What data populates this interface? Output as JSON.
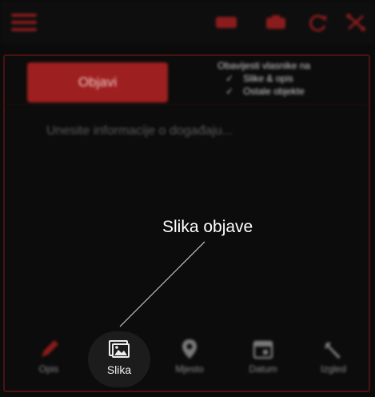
{
  "header": {
    "icons": [
      "menu-icon",
      "ticket-icon",
      "camera-icon",
      "refresh-icon",
      "share-icon"
    ]
  },
  "composer": {
    "publish_label": "Objavi",
    "notify_title": "Obavijesti vlasnike na",
    "notify_options": [
      "Slike & opis",
      "Ostale objekte"
    ],
    "placeholder": "Unesite informacije o događaju..."
  },
  "tabs": [
    {
      "label": "Opis",
      "icon": "pencil-icon"
    },
    {
      "label": "Slika",
      "icon": "image-icon"
    },
    {
      "label": "Mjesto",
      "icon": "location-pin-icon"
    },
    {
      "label": "Datum",
      "icon": "calendar-icon"
    },
    {
      "label": "Izgled",
      "icon": "wrench-icon"
    }
  ],
  "tooltip": {
    "text": "Slika objave"
  },
  "colors": {
    "accent": "#9e1f1f",
    "background": "#0b0b0b"
  }
}
